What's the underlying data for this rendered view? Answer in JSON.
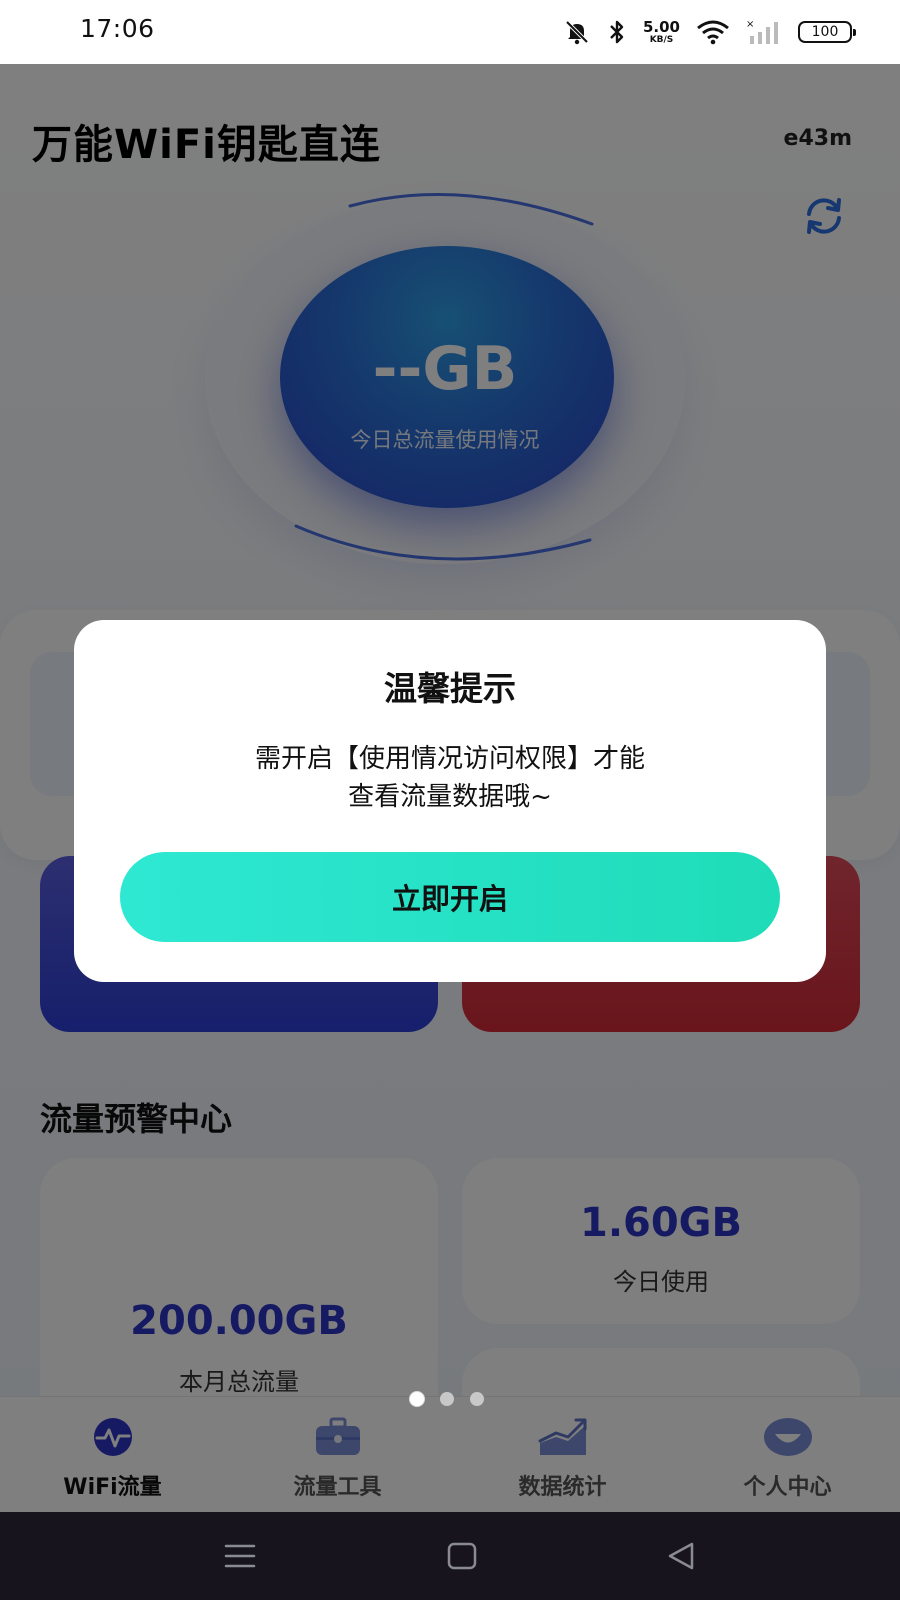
{
  "status_bar": {
    "time": "17:06",
    "net_speed_value": "5.00",
    "net_speed_unit": "KB/S",
    "battery": "100",
    "icons": [
      "bell-muted-icon",
      "bluetooth-icon",
      "wifi-icon",
      "signal-icon",
      "battery-icon"
    ]
  },
  "app": {
    "title": "万能WiFi钥匙直连",
    "code": "e43m"
  },
  "hero": {
    "value": "--GB",
    "subtitle": "今日总流量使用情况"
  },
  "warning_center": {
    "title": "流量预警中心",
    "monthly_total_value": "200.00GB",
    "monthly_total_label": "本月总流量",
    "today_used_value": "1.60GB",
    "today_used_label": "今日使用"
  },
  "tabs": [
    {
      "label": "WiFi流量",
      "icon": "pulse-icon",
      "active": true
    },
    {
      "label": "流量工具",
      "icon": "toolbox-icon",
      "active": false
    },
    {
      "label": "数据统计",
      "icon": "chart-icon",
      "active": false
    },
    {
      "label": "个人中心",
      "icon": "profile-icon",
      "active": false
    }
  ],
  "dialog": {
    "title": "温馨提示",
    "message_line1": "需开启【使用情况访问权限】才能",
    "message_line2": "查看流量数据哦~",
    "button_label": "立即开启"
  },
  "colors": {
    "accent_blue": "#2d34c6",
    "dialog_button": "#21e0c0",
    "overlay": "rgba(0,0,0,0.5)"
  }
}
